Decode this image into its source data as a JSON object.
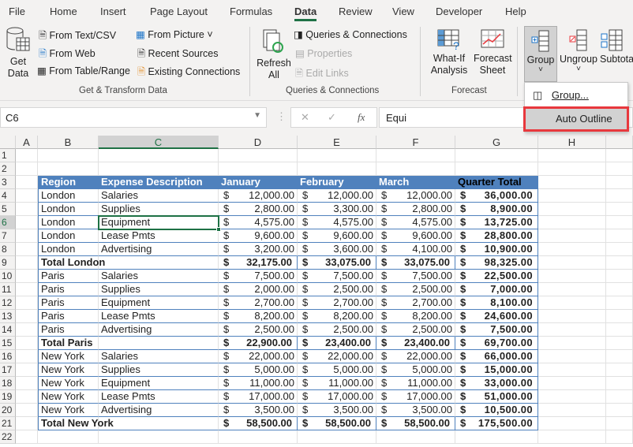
{
  "tabs": [
    "File",
    "Home",
    "Insert",
    "Page Layout",
    "Formulas",
    "Data",
    "Review",
    "View",
    "Developer",
    "Help"
  ],
  "active_tab": "Data",
  "ribbon": {
    "get_data": "Get Data",
    "from_text_csv": "From Text/CSV",
    "from_web": "From Web",
    "from_table_range": "From Table/Range",
    "from_picture": "From Picture",
    "recent_sources": "Recent Sources",
    "existing_connections": "Existing Connections",
    "group_get_transform": "Get & Transform Data",
    "refresh_all": "Refresh All",
    "queries_connections": "Queries & Connections",
    "properties": "Properties",
    "edit_links": "Edit Links",
    "group_queries": "Queries & Connections",
    "what_if": "What-If Analysis",
    "forecast_sheet": "Forecast Sheet",
    "group_forecast": "Forecast",
    "group_btn": "Group",
    "ungroup_btn": "Ungroup",
    "subtotal_btn": "Subtota"
  },
  "group_menu": {
    "items": [
      "Group...",
      "Auto Outline"
    ],
    "highlighted": "Auto Outline"
  },
  "formula_bar": {
    "name_box": "C6",
    "formula": "Equi",
    "fx": "fx"
  },
  "columns": [
    "A",
    "B",
    "C",
    "D",
    "E",
    "F",
    "G",
    "H"
  ],
  "selected_cell": "C6",
  "rows": [
    {
      "n": "1",
      "cells": []
    },
    {
      "n": "2",
      "cells": []
    },
    {
      "n": "3",
      "type": "header",
      "cells": [
        "Region",
        "Expense Description",
        "January",
        "February",
        "March",
        "Quarter Total"
      ]
    },
    {
      "n": "4",
      "cells": [
        "London",
        "Salaries",
        "12,000.00",
        "12,000.00",
        "12,000.00",
        "36,000.00"
      ]
    },
    {
      "n": "5",
      "cells": [
        "London",
        "Supplies",
        "2,800.00",
        "3,300.00",
        "2,800.00",
        "8,900.00"
      ]
    },
    {
      "n": "6",
      "cells": [
        "London",
        "Equipment",
        "4,575.00",
        "4,575.00",
        "4,575.00",
        "13,725.00"
      ]
    },
    {
      "n": "7",
      "cells": [
        "London",
        "Lease Pmts",
        "9,600.00",
        "9,600.00",
        "9,600.00",
        "28,800.00"
      ]
    },
    {
      "n": "8",
      "cells": [
        "London",
        "Advertising",
        "3,200.00",
        "3,600.00",
        "4,100.00",
        "10,900.00"
      ]
    },
    {
      "n": "9",
      "type": "total",
      "cells": [
        "Total London",
        "",
        "32,175.00",
        "33,075.00",
        "33,075.00",
        "98,325.00"
      ]
    },
    {
      "n": "10",
      "cells": [
        "Paris",
        "Salaries",
        "7,500.00",
        "7,500.00",
        "7,500.00",
        "22,500.00"
      ]
    },
    {
      "n": "11",
      "cells": [
        "Paris",
        "Supplies",
        "2,000.00",
        "2,500.00",
        "2,500.00",
        "7,000.00"
      ]
    },
    {
      "n": "12",
      "cells": [
        "Paris",
        "Equipment",
        "2,700.00",
        "2,700.00",
        "2,700.00",
        "8,100.00"
      ]
    },
    {
      "n": "13",
      "cells": [
        "Paris",
        "Lease Pmts",
        "8,200.00",
        "8,200.00",
        "8,200.00",
        "24,600.00"
      ]
    },
    {
      "n": "14",
      "cells": [
        "Paris",
        "Advertising",
        "2,500.00",
        "2,500.00",
        "2,500.00",
        "7,500.00"
      ]
    },
    {
      "n": "15",
      "type": "total",
      "cells": [
        "Total Paris",
        "",
        "22,900.00",
        "23,400.00",
        "23,400.00",
        "69,700.00"
      ]
    },
    {
      "n": "16",
      "cells": [
        "New York",
        "Salaries",
        "22,000.00",
        "22,000.00",
        "22,000.00",
        "66,000.00"
      ]
    },
    {
      "n": "17",
      "cells": [
        "New York",
        "Supplies",
        "5,000.00",
        "5,000.00",
        "5,000.00",
        "15,000.00"
      ]
    },
    {
      "n": "18",
      "cells": [
        "New York",
        "Equipment",
        "11,000.00",
        "11,000.00",
        "11,000.00",
        "33,000.00"
      ]
    },
    {
      "n": "19",
      "cells": [
        "New York",
        "Lease Pmts",
        "17,000.00",
        "17,000.00",
        "17,000.00",
        "51,000.00"
      ]
    },
    {
      "n": "20",
      "cells": [
        "New York",
        "Advertising",
        "3,500.00",
        "3,500.00",
        "3,500.00",
        "10,500.00"
      ]
    },
    {
      "n": "21",
      "type": "total",
      "cells": [
        "Total New York",
        "",
        "58,500.00",
        "58,500.00",
        "58,500.00",
        "175,500.00"
      ]
    },
    {
      "n": "22",
      "cells": []
    }
  ],
  "currency": "$",
  "colors": {
    "accent": "#1e7145",
    "table_header": "#4f81bd",
    "highlight_box": "#e8383d"
  }
}
